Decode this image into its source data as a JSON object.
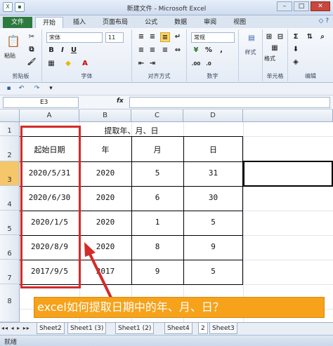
{
  "window": {
    "title": "新建文件 - Microsoft Excel"
  },
  "tabs": [
    "文件",
    "开始",
    "插入",
    "页面布局",
    "公式",
    "数据",
    "审阅",
    "视图"
  ],
  "ribbon": {
    "clipboard": {
      "paste": "粘贴",
      "label": "剪贴板"
    },
    "font": {
      "name": "宋体",
      "size": "11",
      "label": "字体",
      "bold": "B",
      "italic": "I",
      "underline": "U"
    },
    "align": {
      "label": "对齐方式"
    },
    "number": {
      "format": "常规",
      "label": "数字",
      "percent": "%",
      "comma": ","
    },
    "styles": {
      "label": "样式"
    },
    "cells": {
      "label": "单元格",
      "format": "格式"
    },
    "editing": {
      "label": "编辑"
    }
  },
  "formula_bar": {
    "name_box": "E3",
    "fx": "fx"
  },
  "columns": [
    "A",
    "B",
    "C",
    "D"
  ],
  "rows": [
    "1",
    "2",
    "3",
    "4",
    "5",
    "6",
    "7",
    "8"
  ],
  "sheet": {
    "title": "提取年、月、日",
    "headers": [
      "起始日期",
      "年",
      "月",
      "日"
    ],
    "data": [
      [
        "2020/5/31",
        "2020",
        "5",
        "31"
      ],
      [
        "2020/6/30",
        "2020",
        "6",
        "30"
      ],
      [
        "2020/1/5",
        "2020",
        "1",
        "5"
      ],
      [
        "2020/8/9",
        "2020",
        "8",
        "9"
      ],
      [
        "2017/9/5",
        "2017",
        "9",
        "5"
      ]
    ]
  },
  "sheet_tabs": [
    "Sheet2",
    "Sheet1 (3)",
    "Sheet1 (2)",
    "Sheet4",
    "2",
    "Sheet3"
  ],
  "status": "就绪",
  "banner": "excel如何提取日期中的年、月、日？",
  "colors": {
    "accent": "#f6a21a",
    "highlight": "#d42a2a",
    "file_tab": "#2d7a3f"
  }
}
